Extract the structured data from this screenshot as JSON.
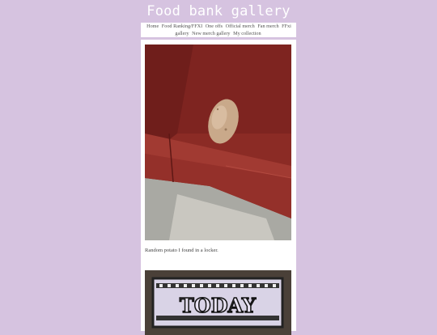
{
  "site": {
    "title": "Food bank gallery"
  },
  "nav": {
    "items": [
      {
        "label": "Home"
      },
      {
        "label": "Food Ranking/FFXI"
      },
      {
        "label": "One offs"
      },
      {
        "label": "Official merch"
      },
      {
        "label": "Fan merch"
      },
      {
        "label": "FFxi gallery"
      },
      {
        "label": "New merch gallery"
      },
      {
        "label": "My collection"
      }
    ]
  },
  "post": {
    "caption": "Random potato I found in a locker.",
    "sign_text": "TODAY"
  },
  "colors": {
    "background": "#d6c3e0",
    "nav_bg": "#ffffff",
    "locker_red": "#8a2a24"
  }
}
